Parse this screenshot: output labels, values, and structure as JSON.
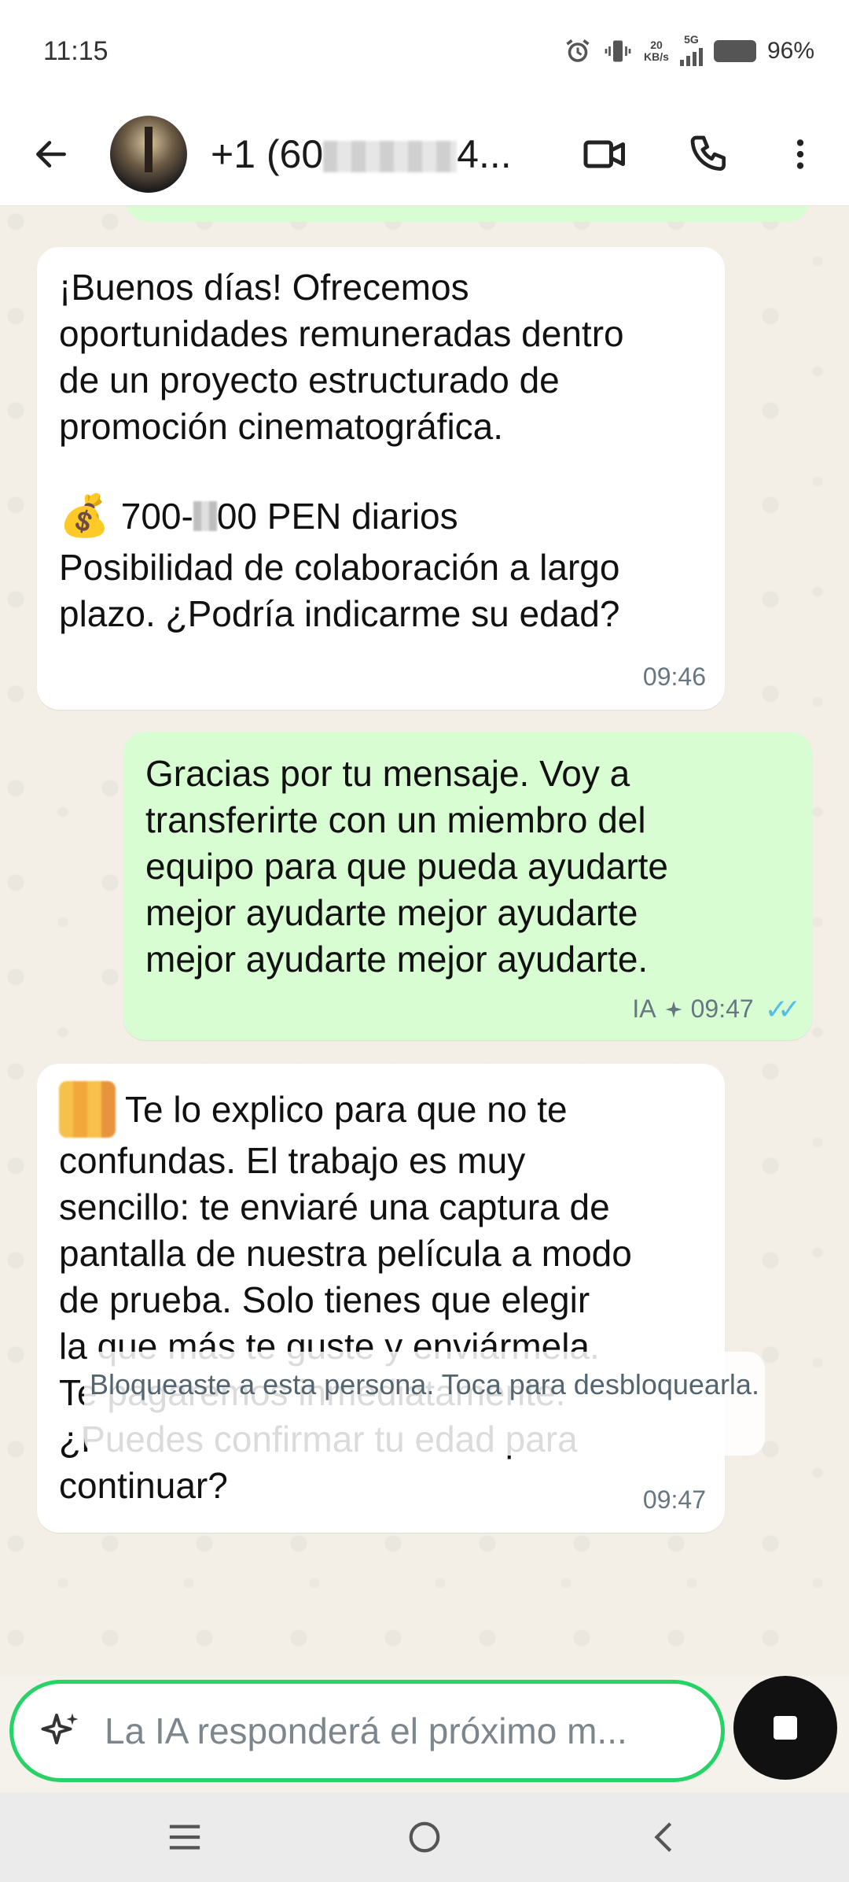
{
  "status_bar": {
    "time": "11:15",
    "net_speed_top": "20",
    "net_speed_bottom": "KB/s",
    "network": "5G",
    "battery": "96%"
  },
  "header": {
    "contact_visible_prefix": "+1 (60",
    "contact_visible_suffix": "4..."
  },
  "messages": [
    {
      "direction": "in",
      "text": "¡Buenos días! Ofrecemos\noportunidades remuneradas dentro\nde un proyecto estructurado de\npromoción cinematográfica.",
      "amount_prefix": "700-",
      "amount_suffix": "00 PEN diarios",
      "text2": "Posibilidad de colaboración a largo\nplazo. ¿Podría indicarme su edad?",
      "time": "09:46"
    },
    {
      "direction": "out",
      "text": "Gracias por tu mensaje. Voy a\ntransferirte con un miembro del\nequipo para que pueda ayudarte\nmejor ayudarte mejor ayudarte\nmejor ayudarte mejor ayudarte.",
      "ia_label": "IA",
      "time": "09:47"
    },
    {
      "direction": "in",
      "first_line": " Te lo explico para que no te",
      "text": "confundas. El trabajo es muy\nsencillo: te enviaré una captura de\npantalla de nuestra película a modo\nde prueba. Solo tienes que elegir\nla que más te guste y enviármela.\nTe pagaremos inmediatamente.\n¿Puedes confirmar tu edad para\ncontinuar?",
      "time": "09:47"
    }
  ],
  "system_note": "Bloqueaste a esta persona. Toca para desbloquearla.",
  "input": {
    "placeholder": "La IA responderá el próximo m..."
  },
  "colors": {
    "outgoing_bubble": "#d9fdd3",
    "incoming_bubble": "#ffffff",
    "accent_green": "#25d366",
    "read_ticks": "#53bdeb"
  },
  "icons": [
    "back-arrow-icon",
    "video-call-icon",
    "phone-icon",
    "more-vert-icon",
    "sparkle-ai-icon",
    "stop-icon",
    "menu-nav-icon",
    "home-nav-icon",
    "back-nav-icon"
  ]
}
